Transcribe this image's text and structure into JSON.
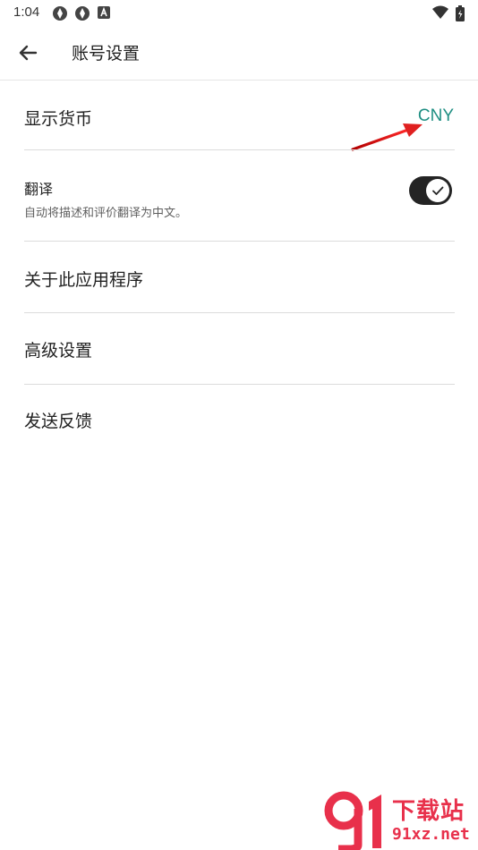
{
  "status_bar": {
    "time": "1:04",
    "icons": [
      "app-notification-icon",
      "app-notification-icon",
      "keyboard-a-icon",
      "wifi-icon",
      "battery-icon"
    ]
  },
  "app_bar": {
    "title": "账号设置",
    "back_icon": "back-arrow-icon"
  },
  "settings": {
    "currency": {
      "label": "显示货币",
      "value": "CNY"
    },
    "translate": {
      "title": "翻译",
      "subtitle": "自动将描述和评价翻译为中文。",
      "enabled": true
    },
    "about": {
      "label": "关于此应用程序"
    },
    "advanced": {
      "label": "高级设置"
    },
    "feedback": {
      "label": "发送反馈"
    }
  },
  "annotation": {
    "arrow_color": "#e02020"
  },
  "watermark": {
    "logo": "91",
    "text": "下载站",
    "domain": "91xz.net"
  },
  "colors": {
    "accent": "#1e8e82",
    "toggle_track": "#242424"
  }
}
